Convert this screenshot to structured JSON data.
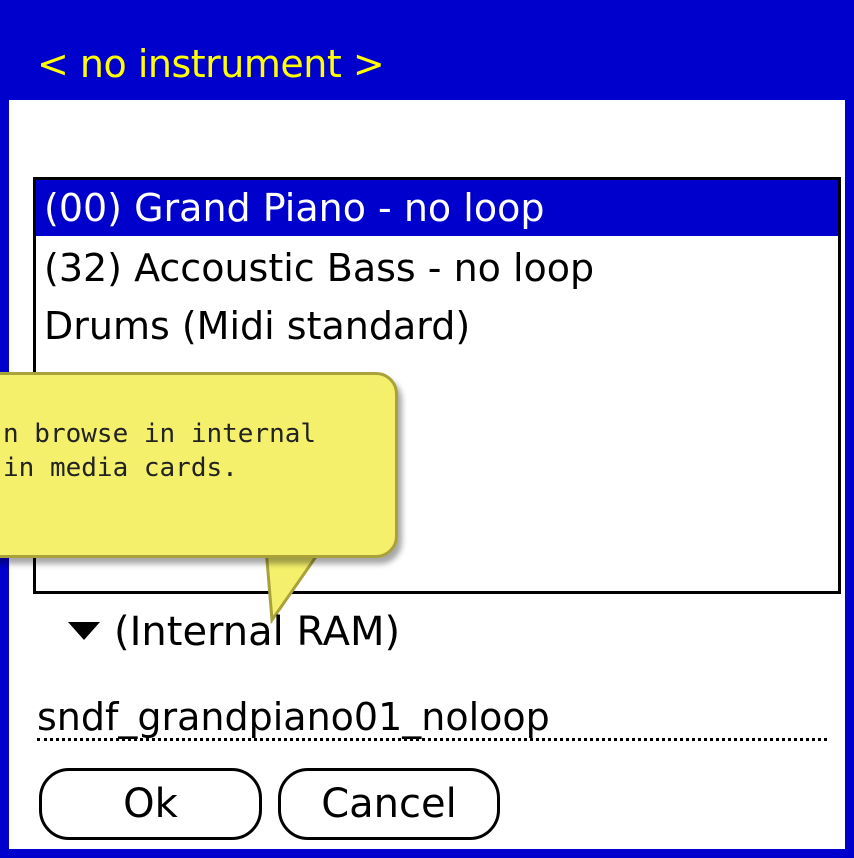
{
  "dialog": {
    "title": "< no instrument >"
  },
  "list": {
    "items": [
      {
        "label": "(00) Grand Piano - no loop",
        "selected": true
      },
      {
        "label": "(32) Accoustic Bass - no loop",
        "selected": false
      },
      {
        "label": "Drums (Midi standard)",
        "selected": false
      }
    ]
  },
  "tooltip": {
    "line1": "n browse in internal",
    "line2": "in media cards."
  },
  "location": {
    "value": "(Internal RAM)",
    "icon": "triangle-down-icon"
  },
  "filename": {
    "value": "sndf_grandpiano01_noloop"
  },
  "buttons": {
    "ok": "Ok",
    "cancel": "Cancel"
  },
  "colors": {
    "title_bg": "#0000cc",
    "title_text": "#ffff00",
    "selection": "#0000cc",
    "tooltip_bg": "#f4f06b"
  }
}
